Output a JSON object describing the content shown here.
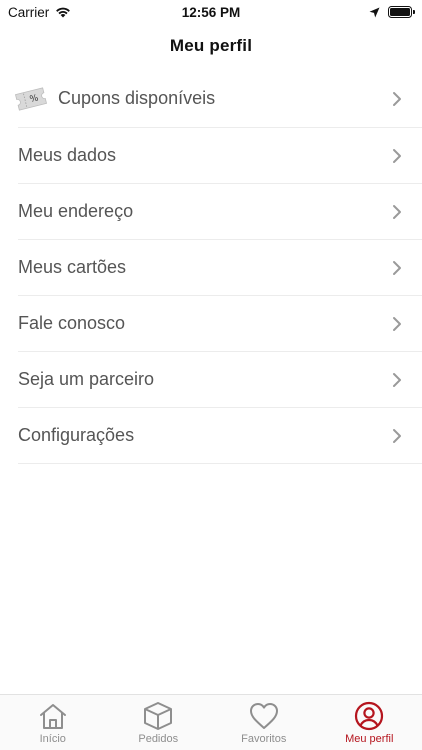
{
  "status_bar": {
    "carrier": "Carrier",
    "time": "12:56 PM"
  },
  "header": {
    "title": "Meu perfil"
  },
  "menu": {
    "items": [
      {
        "label": "Cupons disponíveis",
        "icon": "coupon-icon"
      },
      {
        "label": "Meus dados"
      },
      {
        "label": "Meu endereço"
      },
      {
        "label": "Meus cartões"
      },
      {
        "label": "Fale conosco"
      },
      {
        "label": "Seja um parceiro"
      },
      {
        "label": "Configurações"
      }
    ]
  },
  "tab_bar": {
    "tabs": [
      {
        "label": "Início",
        "icon": "home-icon",
        "active": false
      },
      {
        "label": "Pedidos",
        "icon": "box-icon",
        "active": false
      },
      {
        "label": "Favoritos",
        "icon": "heart-icon",
        "active": false
      },
      {
        "label": "Meu perfil",
        "icon": "profile-icon",
        "active": true
      }
    ]
  },
  "colors": {
    "accent": "#b5151e",
    "inactive_tab": "#8e8e8e",
    "menu_text": "#555555",
    "chevron": "#9a9a9a"
  }
}
